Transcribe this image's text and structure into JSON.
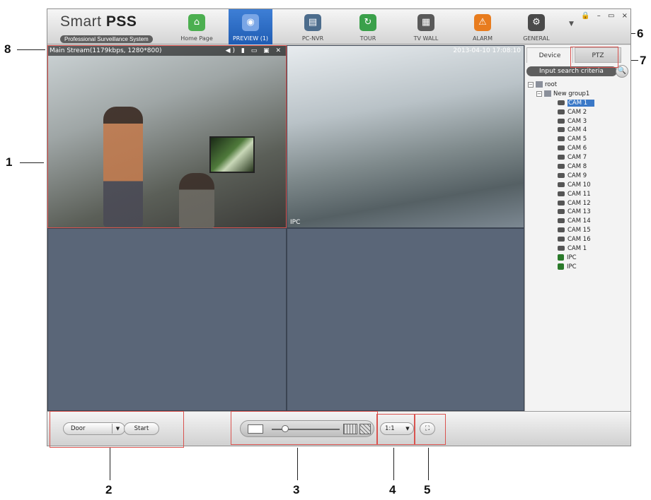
{
  "callouts": [
    "1",
    "2",
    "3",
    "4",
    "5",
    "6",
    "7",
    "8"
  ],
  "app": {
    "logo_title_light": "Smart ",
    "logo_title_bold": "PSS",
    "logo_subtitle": "Professional Surveillance System"
  },
  "nav": [
    {
      "label": "Home Page",
      "icon": "home-icon",
      "color": "#4caf50"
    },
    {
      "label": "PREVIEW (1)",
      "icon": "camera-icon",
      "color": "#4a78c6",
      "active": true
    },
    {
      "label": "PC-NVR",
      "icon": "pc-nvr-icon",
      "color": "#4c6c8c"
    },
    {
      "label": "TOUR",
      "icon": "tour-icon",
      "color": "#3aa04a"
    },
    {
      "label": "TV WALL",
      "icon": "tv-wall-icon",
      "color": "#5a5a5a"
    },
    {
      "label": "ALARM",
      "icon": "alarm-icon",
      "color": "#e87c1e"
    },
    {
      "label": "GENERAL",
      "icon": "gear-icon",
      "color": "#4a4a4a"
    }
  ],
  "window_controls": {
    "lock": "🔒",
    "minimize": "–",
    "maximize": "▭",
    "close": "×"
  },
  "video": {
    "stream_info": "Main Stream(1179kbps, 1280*800)",
    "stream_icons": "◀) ▮ ▭ ▣ ✕",
    "timestamp": "2013-04-10 17:08:10",
    "channel_label": "IPC"
  },
  "right_panel": {
    "tab_device": "Device",
    "tab_ptz": "PTZ",
    "search_placeholder": "Input search criteria",
    "search_icon": "🔍",
    "root_label": "root",
    "group_label": "New group1",
    "cameras": [
      "CAM 1",
      "CAM 2",
      "CAM 3",
      "CAM 4",
      "CAM 5",
      "CAM 6",
      "CAM 7",
      "CAM 8",
      "CAM 9",
      "CAM 10",
      "CAM 11",
      "CAM 12",
      "CAM 13",
      "CAM 14",
      "CAM 15",
      "CAM 16",
      "CAM 1"
    ],
    "ipcs": [
      "IPC",
      "IPC"
    ],
    "selected_index": 0
  },
  "bottom": {
    "door_select_value": "Door",
    "start_button": "Start",
    "ratio_value": "1:1",
    "dropdown_arrow": "▼",
    "fullscreen_icon": "⛶"
  }
}
